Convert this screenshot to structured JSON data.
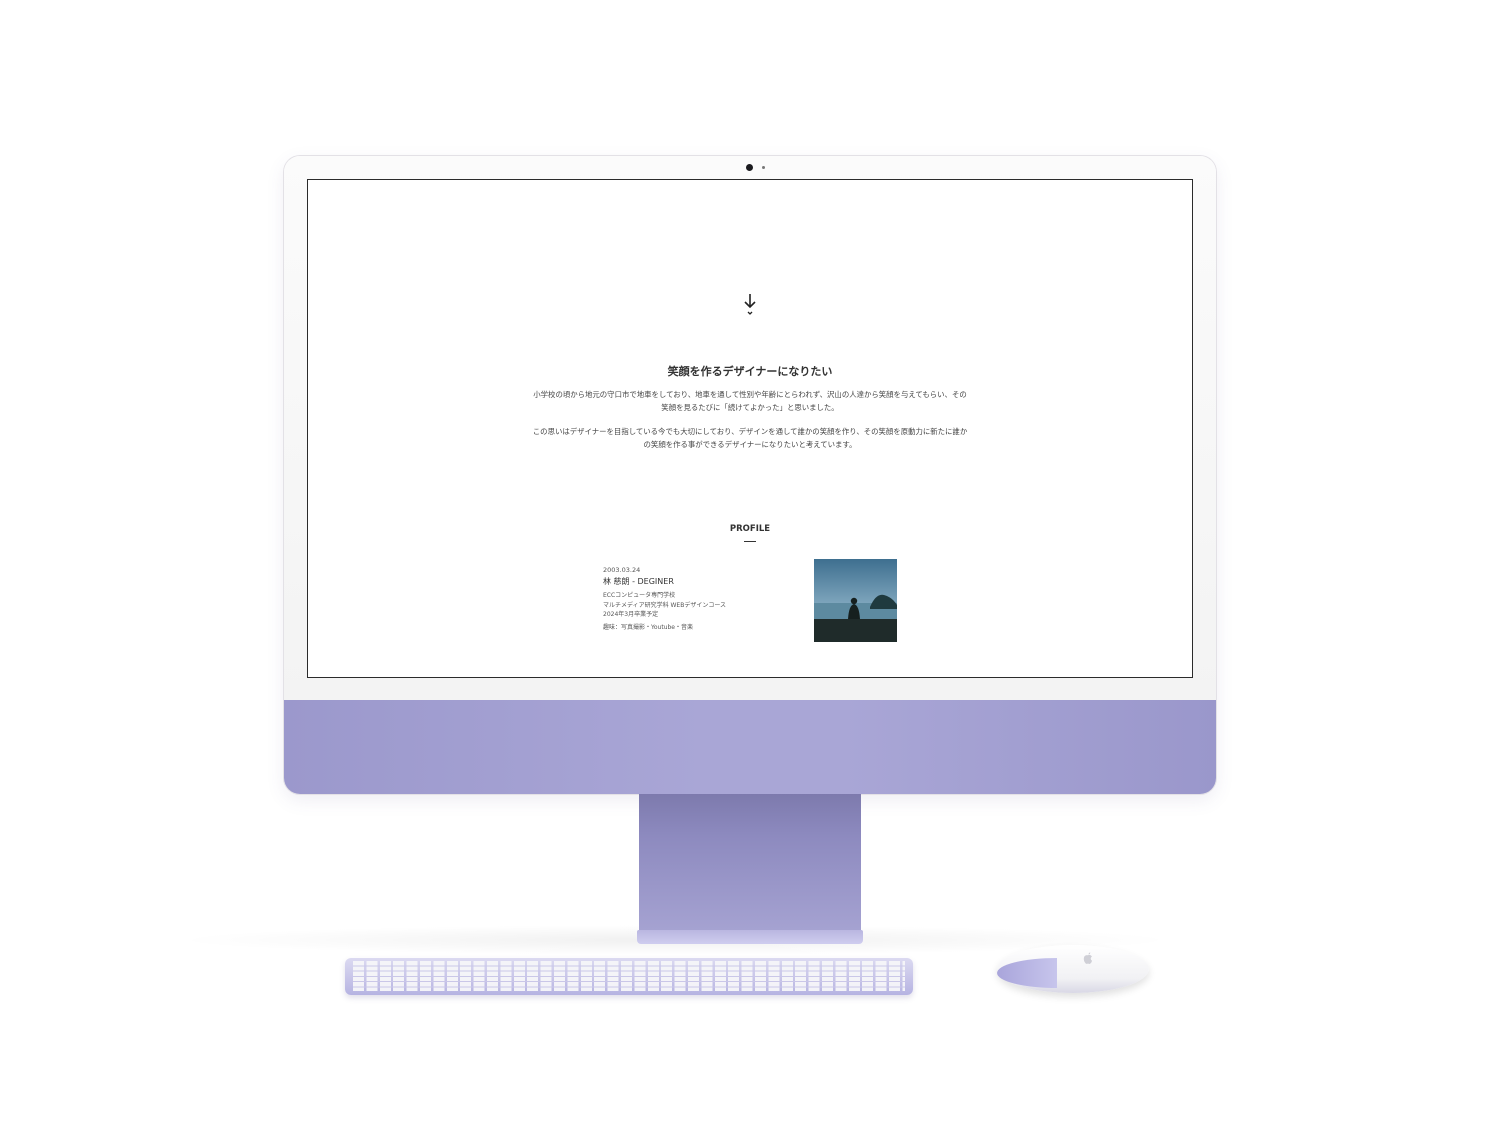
{
  "device": {
    "accent_color": "#a9a6d6",
    "stand_color": "#8d8abf"
  },
  "page": {
    "scroll_icon": "down-arrow-icon",
    "headline": "笑顔を作るデザイナーになりたい",
    "intro_paragraph_1": "小学校の頃から地元の守口市で地車をしており、地車を通して性別や年齢にとらわれず、沢山の人達から笑顔を与えてもらい、その笑顔を見るたびに「続けてよかった」と思いました。",
    "intro_paragraph_2": "この思いはデザイナーを目指している今でも大切にしており、デザインを通して誰かの笑顔を作り、その笑顔を原動力に新たに誰かの笑顔を作る事ができるデザイナーになりたいと考えています。",
    "profile": {
      "heading": "PROFILE",
      "date": "2003.03.24",
      "name": "林 慈朗 - DEGINER",
      "school": "ECCコンピュータ専門学校",
      "department": "マルチメディア研究学科 WEBデザインコース",
      "graduation": "2024年3月卒業予定",
      "hobbies": "趣味：写真撮影・Youtube・音楽"
    }
  }
}
